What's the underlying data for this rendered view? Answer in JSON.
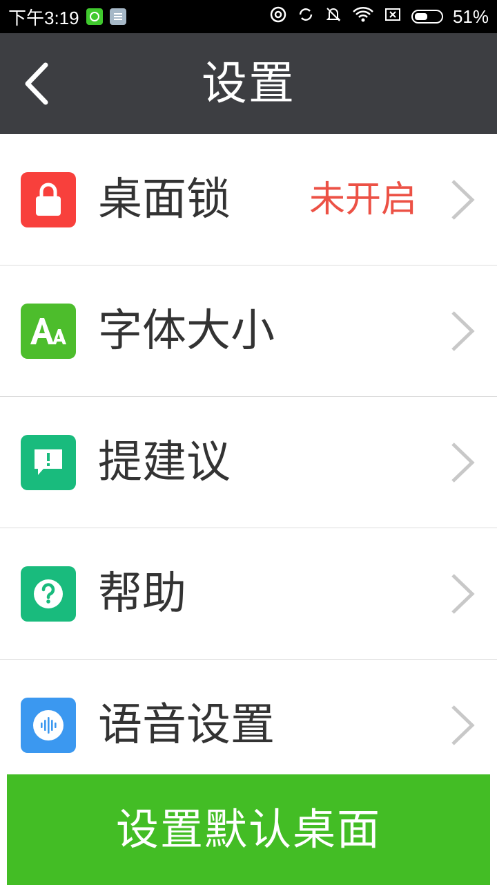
{
  "status_bar": {
    "time": "下午3:19",
    "battery": "51%",
    "icons": [
      "wechat-app-icon",
      "notes-app-icon",
      "nfc-icon",
      "sync-icon",
      "mute-icon",
      "wifi-icon",
      "no-sim-icon",
      "battery-icon"
    ]
  },
  "header": {
    "title": "设置",
    "back_icon": "chevron-left-icon"
  },
  "menu": {
    "items": [
      {
        "label": "桌面锁",
        "status": "未开启",
        "icon": "lock-icon",
        "color": "#f8403c"
      },
      {
        "label": "字体大小",
        "status": "",
        "icon": "font-size-icon",
        "color": "#4dbd2c"
      },
      {
        "label": "提建议",
        "status": "",
        "icon": "feedback-icon",
        "color": "#19bb7d"
      },
      {
        "label": "帮助",
        "status": "",
        "icon": "help-icon",
        "color": "#19bb7d"
      },
      {
        "label": "语音设置",
        "status": "",
        "icon": "voice-icon",
        "color": "#3b98f0"
      }
    ]
  },
  "bottom_button": {
    "label": "设置默认桌面",
    "color": "#43bd25"
  },
  "colors": {
    "header_bg": "#3d3e42",
    "status_text": "#ec5145"
  }
}
